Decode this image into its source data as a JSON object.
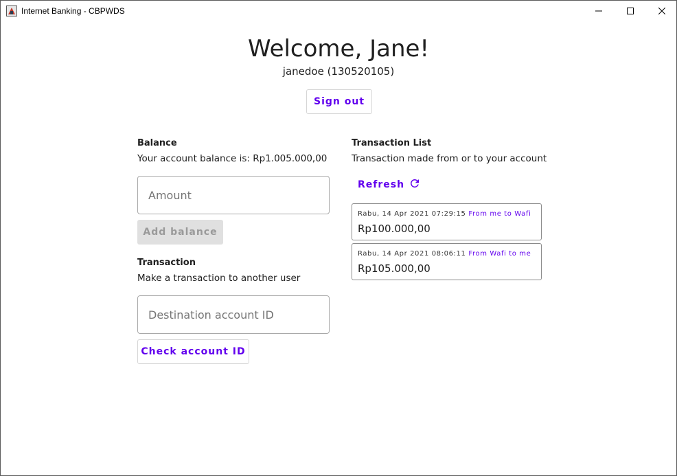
{
  "window": {
    "title": "Internet Banking - CBPWDS"
  },
  "header": {
    "welcome": "Welcome, Jane!",
    "username": "janedoe (130520105)",
    "signout_label": "Sign out"
  },
  "balance": {
    "title": "Balance",
    "description": "Your account balance is: Rp1.005.000,00",
    "amount_placeholder": "Amount",
    "add_label": "Add balance"
  },
  "transaction": {
    "title": "Transaction",
    "description": "Make a transaction to another user",
    "dest_placeholder": "Destination account ID",
    "check_label": "Check account ID"
  },
  "transaction_list": {
    "title": "Transaction List",
    "description": "Transaction made from or to your account",
    "refresh_label": "Refresh",
    "items": [
      {
        "datetime": "Rabu, 14 Apr 2021 07:29:15",
        "direction": "From me to Wafi",
        "amount": "Rp100.000,00"
      },
      {
        "datetime": "Rabu, 14 Apr 2021 08:06:11",
        "direction": "From Wafi to me",
        "amount": "Rp105.000,00"
      }
    ]
  },
  "colors": {
    "accent": "#6200ee",
    "disabled_bg": "#e0e0e0",
    "text": "#202020"
  },
  "icons": {
    "app": "app-icon",
    "refresh": "refresh-icon",
    "minimize": "minimize-icon",
    "maximize": "maximize-icon",
    "close": "close-icon"
  }
}
